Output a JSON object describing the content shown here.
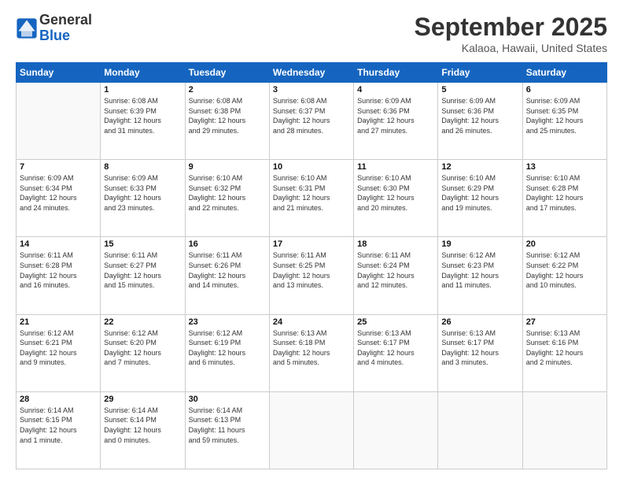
{
  "logo": {
    "line1": "General",
    "line2": "Blue"
  },
  "title": "September 2025",
  "location": "Kalaoa, Hawaii, United States",
  "weekdays": [
    "Sunday",
    "Monday",
    "Tuesday",
    "Wednesday",
    "Thursday",
    "Friday",
    "Saturday"
  ],
  "weeks": [
    [
      {
        "day": "",
        "info": ""
      },
      {
        "day": "1",
        "info": "Sunrise: 6:08 AM\nSunset: 6:39 PM\nDaylight: 12 hours\nand 31 minutes."
      },
      {
        "day": "2",
        "info": "Sunrise: 6:08 AM\nSunset: 6:38 PM\nDaylight: 12 hours\nand 29 minutes."
      },
      {
        "day": "3",
        "info": "Sunrise: 6:08 AM\nSunset: 6:37 PM\nDaylight: 12 hours\nand 28 minutes."
      },
      {
        "day": "4",
        "info": "Sunrise: 6:09 AM\nSunset: 6:36 PM\nDaylight: 12 hours\nand 27 minutes."
      },
      {
        "day": "5",
        "info": "Sunrise: 6:09 AM\nSunset: 6:36 PM\nDaylight: 12 hours\nand 26 minutes."
      },
      {
        "day": "6",
        "info": "Sunrise: 6:09 AM\nSunset: 6:35 PM\nDaylight: 12 hours\nand 25 minutes."
      }
    ],
    [
      {
        "day": "7",
        "info": "Sunrise: 6:09 AM\nSunset: 6:34 PM\nDaylight: 12 hours\nand 24 minutes."
      },
      {
        "day": "8",
        "info": "Sunrise: 6:09 AM\nSunset: 6:33 PM\nDaylight: 12 hours\nand 23 minutes."
      },
      {
        "day": "9",
        "info": "Sunrise: 6:10 AM\nSunset: 6:32 PM\nDaylight: 12 hours\nand 22 minutes."
      },
      {
        "day": "10",
        "info": "Sunrise: 6:10 AM\nSunset: 6:31 PM\nDaylight: 12 hours\nand 21 minutes."
      },
      {
        "day": "11",
        "info": "Sunrise: 6:10 AM\nSunset: 6:30 PM\nDaylight: 12 hours\nand 20 minutes."
      },
      {
        "day": "12",
        "info": "Sunrise: 6:10 AM\nSunset: 6:29 PM\nDaylight: 12 hours\nand 19 minutes."
      },
      {
        "day": "13",
        "info": "Sunrise: 6:10 AM\nSunset: 6:28 PM\nDaylight: 12 hours\nand 17 minutes."
      }
    ],
    [
      {
        "day": "14",
        "info": "Sunrise: 6:11 AM\nSunset: 6:28 PM\nDaylight: 12 hours\nand 16 minutes."
      },
      {
        "day": "15",
        "info": "Sunrise: 6:11 AM\nSunset: 6:27 PM\nDaylight: 12 hours\nand 15 minutes."
      },
      {
        "day": "16",
        "info": "Sunrise: 6:11 AM\nSunset: 6:26 PM\nDaylight: 12 hours\nand 14 minutes."
      },
      {
        "day": "17",
        "info": "Sunrise: 6:11 AM\nSunset: 6:25 PM\nDaylight: 12 hours\nand 13 minutes."
      },
      {
        "day": "18",
        "info": "Sunrise: 6:11 AM\nSunset: 6:24 PM\nDaylight: 12 hours\nand 12 minutes."
      },
      {
        "day": "19",
        "info": "Sunrise: 6:12 AM\nSunset: 6:23 PM\nDaylight: 12 hours\nand 11 minutes."
      },
      {
        "day": "20",
        "info": "Sunrise: 6:12 AM\nSunset: 6:22 PM\nDaylight: 12 hours\nand 10 minutes."
      }
    ],
    [
      {
        "day": "21",
        "info": "Sunrise: 6:12 AM\nSunset: 6:21 PM\nDaylight: 12 hours\nand 9 minutes."
      },
      {
        "day": "22",
        "info": "Sunrise: 6:12 AM\nSunset: 6:20 PM\nDaylight: 12 hours\nand 7 minutes."
      },
      {
        "day": "23",
        "info": "Sunrise: 6:12 AM\nSunset: 6:19 PM\nDaylight: 12 hours\nand 6 minutes."
      },
      {
        "day": "24",
        "info": "Sunrise: 6:13 AM\nSunset: 6:18 PM\nDaylight: 12 hours\nand 5 minutes."
      },
      {
        "day": "25",
        "info": "Sunrise: 6:13 AM\nSunset: 6:17 PM\nDaylight: 12 hours\nand 4 minutes."
      },
      {
        "day": "26",
        "info": "Sunrise: 6:13 AM\nSunset: 6:17 PM\nDaylight: 12 hours\nand 3 minutes."
      },
      {
        "day": "27",
        "info": "Sunrise: 6:13 AM\nSunset: 6:16 PM\nDaylight: 12 hours\nand 2 minutes."
      }
    ],
    [
      {
        "day": "28",
        "info": "Sunrise: 6:14 AM\nSunset: 6:15 PM\nDaylight: 12 hours\nand 1 minute."
      },
      {
        "day": "29",
        "info": "Sunrise: 6:14 AM\nSunset: 6:14 PM\nDaylight: 12 hours\nand 0 minutes."
      },
      {
        "day": "30",
        "info": "Sunrise: 6:14 AM\nSunset: 6:13 PM\nDaylight: 11 hours\nand 59 minutes."
      },
      {
        "day": "",
        "info": ""
      },
      {
        "day": "",
        "info": ""
      },
      {
        "day": "",
        "info": ""
      },
      {
        "day": "",
        "info": ""
      }
    ]
  ]
}
